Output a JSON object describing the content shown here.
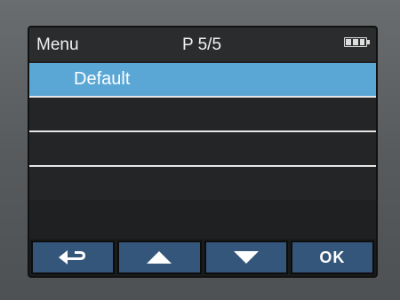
{
  "header": {
    "title": "Menu",
    "page": "P 5/5"
  },
  "list": {
    "items": [
      {
        "label": "Default",
        "selected": true
      },
      {
        "label": "",
        "selected": false
      },
      {
        "label": "",
        "selected": false
      },
      {
        "label": "",
        "selected": false
      }
    ]
  },
  "toolbar": {
    "buttons": [
      {
        "icon": "back-arrow-icon"
      },
      {
        "icon": "up-triangle-icon"
      },
      {
        "icon": "down-triangle-icon"
      },
      {
        "label": "OK"
      }
    ]
  },
  "colors": {
    "selected_row": "#5aa7d6",
    "button_bg": "#34567a",
    "screen_bg": "#1f2021"
  }
}
